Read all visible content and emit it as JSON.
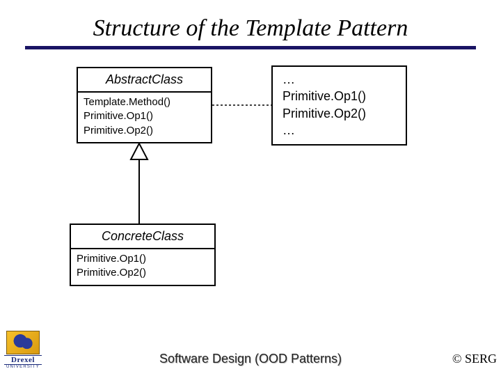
{
  "title": "Structure of the Template Pattern",
  "abstract": {
    "name": "AbstractClass",
    "ops": "Template.Method()\nPrimitive.Op1()\nPrimitive.Op2()"
  },
  "concrete": {
    "name": "ConcreteClass",
    "ops": "Primitive.Op1()\nPrimitive.Op2()"
  },
  "note": "…\nPrimitive.Op1()\nPrimitive.Op2()\n…",
  "footer_center": "Software Design (OOD Patterns)",
  "footer_right": "© SERG",
  "logo": {
    "word": "Drexel",
    "sub": "UNIVERSITY"
  }
}
